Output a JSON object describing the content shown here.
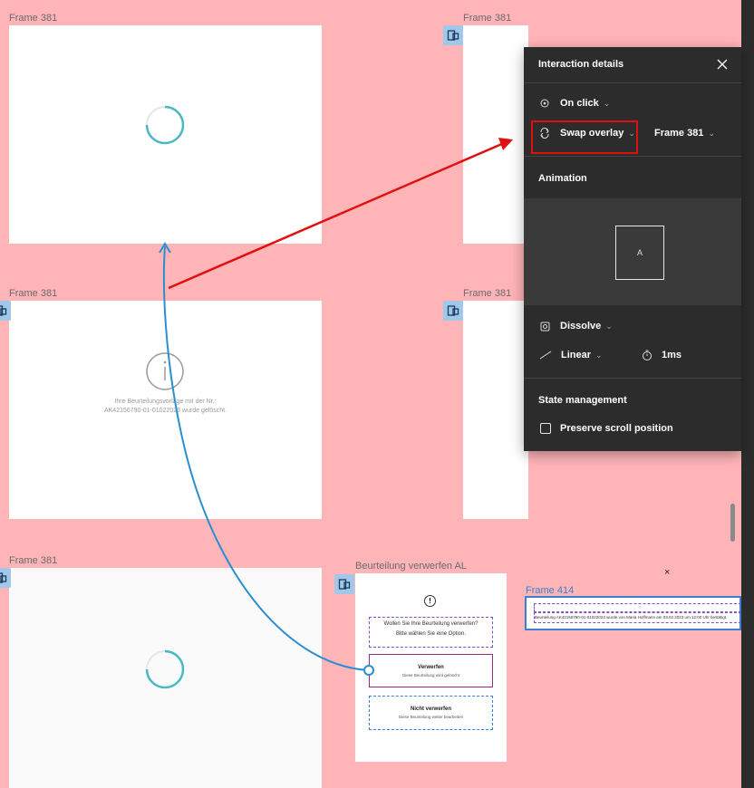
{
  "frames": {
    "label": "Frame 381",
    "second_frame_text_line1": "Ihre Beurteilungsvorlage mit der Nr.:",
    "second_frame_text_line2": "AK42156790-01-01022023 wurde gelöscht.",
    "info_glyph": "i"
  },
  "component": {
    "title": "Beurteilung verwerfen AL",
    "info_glyph": "!",
    "question_line1": "Wollen Sie Ihre Beurteilung verwerfen?",
    "question_line2": "Bitte wählen Sie eine Option.",
    "option1_title": "Verwerfen",
    "option1_sub": "Diese Beurteilung wird gelöscht",
    "option2_title": "Nicht verwerfen",
    "option2_sub": "Diese Beurteilung weiter bearbeiten"
  },
  "frame414": {
    "label": "Frame 414",
    "close_glyph": "×",
    "inner_glyph": "○",
    "text": "Beurteilung AK42156790-01-01022023 wurde von Maria Hoffmann am 03.02.2023 um 12:00 Uhr bestätigt."
  },
  "panel": {
    "title": "Interaction details",
    "trigger": "On click",
    "action": "Swap overlay",
    "destination": "Frame 381",
    "animation_heading": "Animation",
    "preview_letter": "A",
    "transition": "Dissolve",
    "easing": "Linear",
    "duration": "1ms",
    "state_heading": "State management",
    "preserve_scroll": "Preserve scroll position",
    "preserve_scroll_checked": false
  },
  "colors": {
    "canvas": "#ffb4b8",
    "panel": "#2c2c2c",
    "highlight_red": "#e01010",
    "connector_blue": "#2a8fd0",
    "spinner_teal": "#49b9c2"
  }
}
